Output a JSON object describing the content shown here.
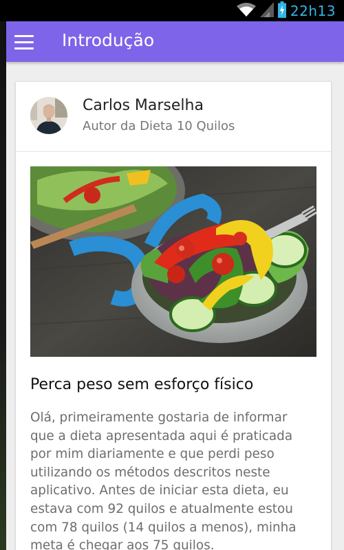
{
  "status_bar": {
    "time": "22h13",
    "icons": [
      "wifi-icon",
      "signal-icon",
      "battery-charging-icon"
    ],
    "color": "#33b5e5"
  },
  "app_bar": {
    "title": "Introdução",
    "menu_icon": "hamburger-menu-icon",
    "color": "#7e64e8"
  },
  "author": {
    "name": "Carlos Marselha",
    "subtitle": "Autor da Dieta 10 Quilos"
  },
  "hero_image": {
    "subject": "salad-with-measuring-tape"
  },
  "article": {
    "title": "Perca peso sem esforço físico",
    "body": "Olá, primeiramente gostaria de informar que a dieta apresentada aqui é praticada por mim diariamente e que perdi peso utilizando os métodos descritos neste aplicativo. Antes de iniciar esta dieta, eu estava com 92 quilos e atualmente estou com 78 quilos (14 quilos a menos), minha meta é chegar aos 75 quilos."
  }
}
